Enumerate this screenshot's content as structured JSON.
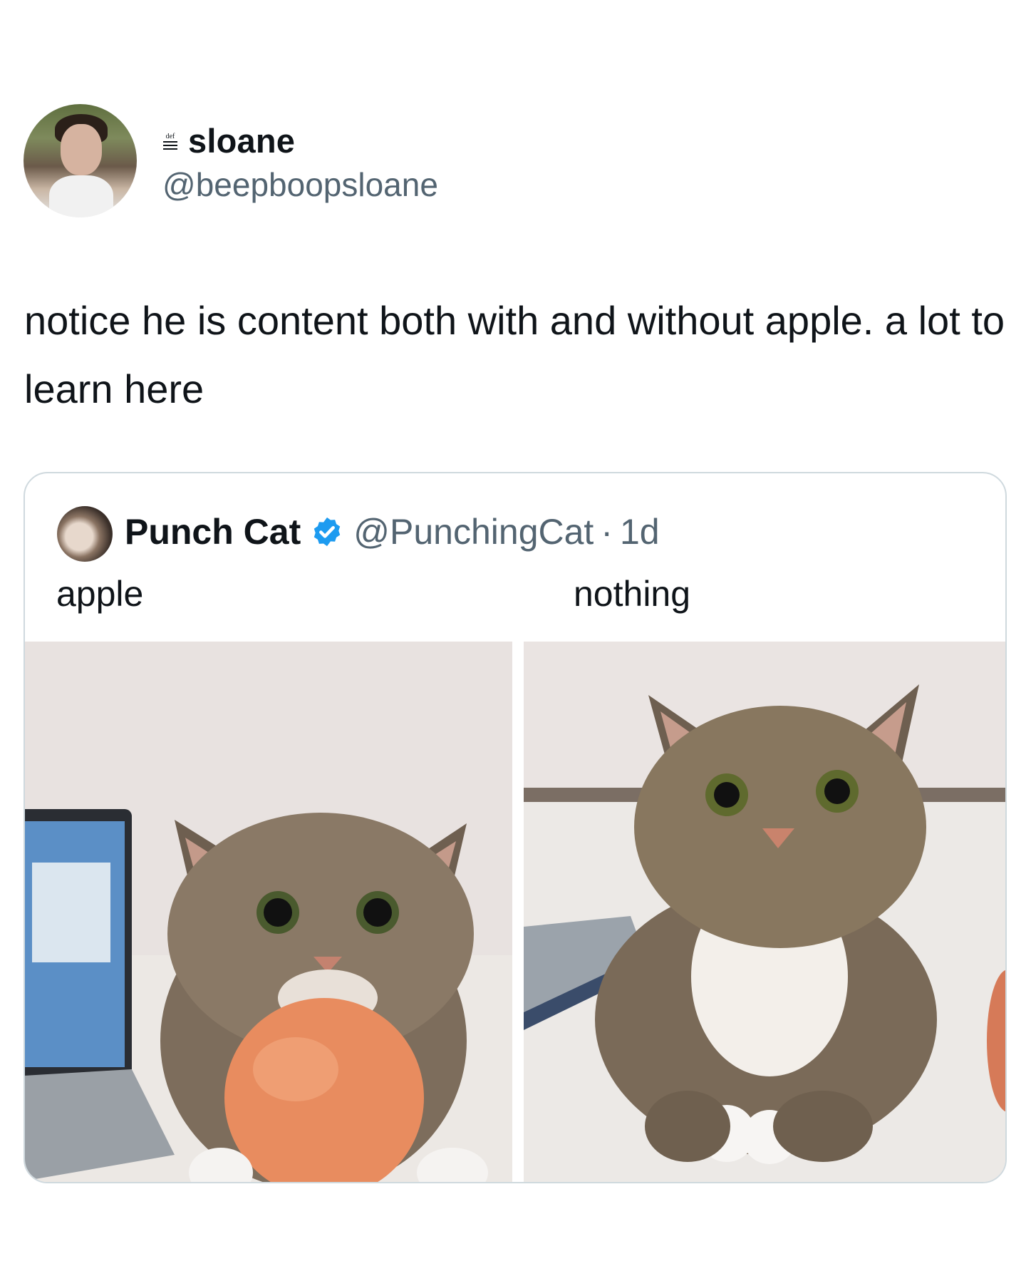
{
  "author": {
    "display_name": "sloane",
    "handle": "@beepboopsloane",
    "name_icon": "def-icon",
    "avatar_icon": "profile-photo"
  },
  "tweet": {
    "text": "notice he is content both with and without apple. a lot to learn here"
  },
  "quoted_tweet": {
    "display_name": "Punch Cat",
    "verified": true,
    "handle": "@PunchingCat",
    "separator": "·",
    "time": "1d",
    "labels": [
      "apple",
      "nothing"
    ],
    "images": [
      {
        "name": "cat-with-apple-photo"
      },
      {
        "name": "cat-without-apple-photo"
      }
    ]
  },
  "colors": {
    "text_primary": "#0f1419",
    "text_secondary": "#536471",
    "border": "#cfd9de",
    "verified_blue": "#1d9bf0"
  }
}
